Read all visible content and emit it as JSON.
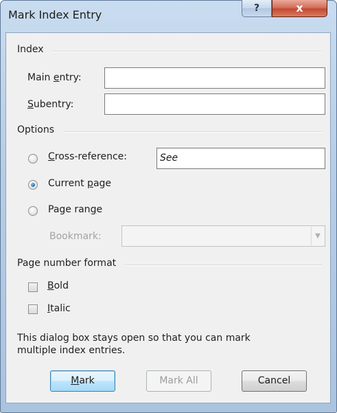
{
  "window": {
    "title": "Mark Index Entry",
    "help_glyph": "?",
    "close_glyph": "x"
  },
  "index": {
    "group_title": "Index",
    "main_entry": {
      "pre": "Main ",
      "key": "e",
      "post": "ntry:",
      "value": ""
    },
    "subentry": {
      "pre": "",
      "key": "S",
      "post": "ubentry:",
      "value": ""
    }
  },
  "options": {
    "group_title": "Options",
    "cross_reference": {
      "pre": "",
      "key": "C",
      "post": "ross-reference:",
      "value": "See",
      "selected": false
    },
    "current_page": {
      "pre": "Current ",
      "key": "p",
      "post": "age",
      "selected": true
    },
    "page_range": {
      "pre": "Page ran",
      "key": "g",
      "post": "e",
      "selected": false
    },
    "bookmark": {
      "label": "Bookmark:",
      "value": "",
      "enabled": false
    }
  },
  "page_number_format": {
    "group_title": "Page number format",
    "bold": {
      "pre": "",
      "key": "B",
      "post": "old",
      "checked": false
    },
    "italic": {
      "pre": "",
      "key": "I",
      "post": "talic",
      "checked": false
    }
  },
  "info_text_line1": "This dialog box stays open so that you can mark",
  "info_text_line2": "multiple index entries.",
  "buttons": {
    "mark": {
      "pre": "",
      "key": "M",
      "post": "ark"
    },
    "mark_all": "Mark All",
    "cancel": "Cancel"
  },
  "colors": {
    "frame": "#b6cde6",
    "close_button": "#c44a30",
    "radio_selected": "#2c73c1",
    "default_button_border": "#3c7fb1"
  }
}
